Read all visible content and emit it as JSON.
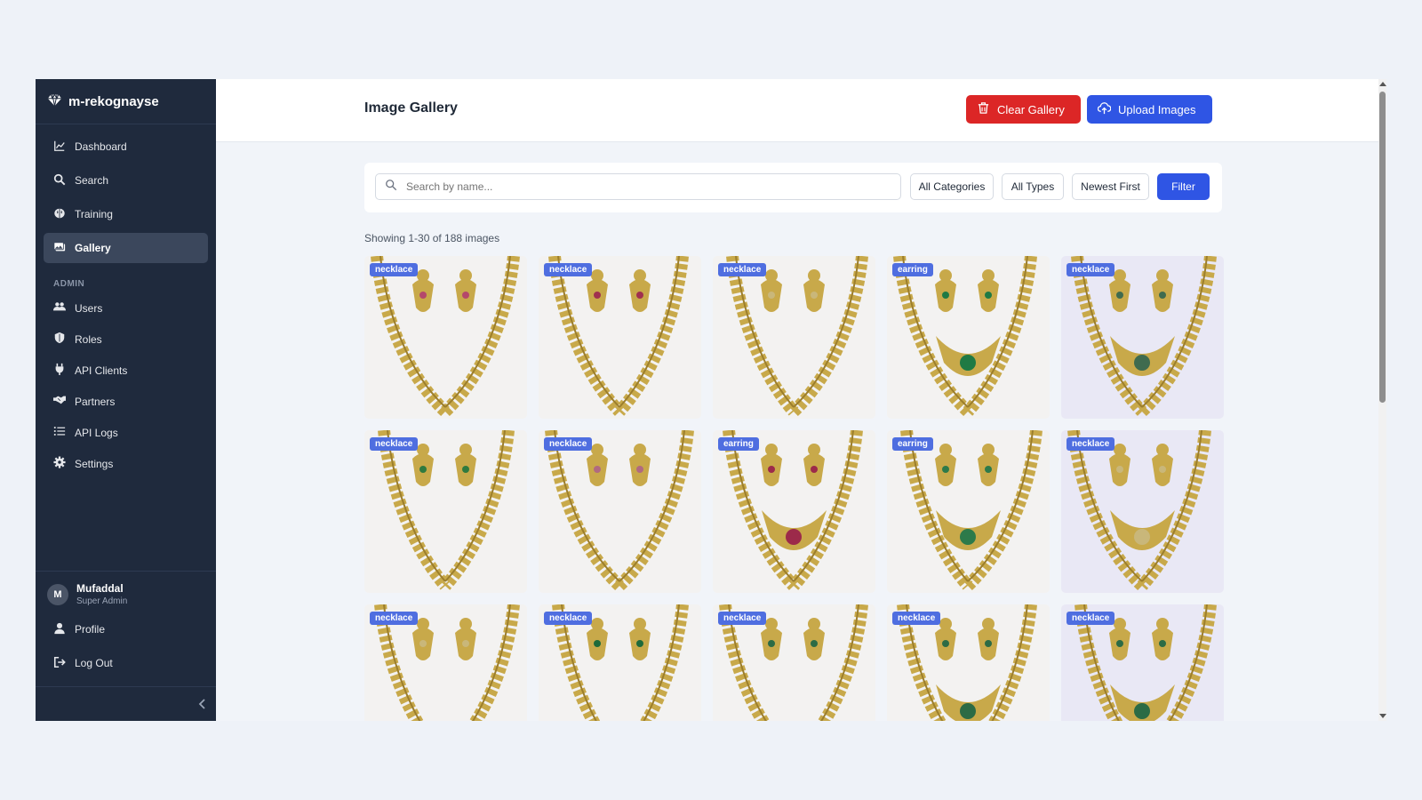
{
  "brand": {
    "name": "m-rekognayse"
  },
  "sidebar": {
    "items": [
      {
        "label": "Dashboard",
        "icon": "chart-line-icon"
      },
      {
        "label": "Search",
        "icon": "search-icon"
      },
      {
        "label": "Training",
        "icon": "brain-icon"
      },
      {
        "label": "Gallery",
        "icon": "images-icon",
        "active": true
      }
    ],
    "admin_label": "ADMIN",
    "admin_items": [
      {
        "label": "Users",
        "icon": "users-icon"
      },
      {
        "label": "Roles",
        "icon": "shield-icon"
      },
      {
        "label": "API Clients",
        "icon": "plug-icon"
      },
      {
        "label": "Partners",
        "icon": "handshake-icon"
      },
      {
        "label": "API Logs",
        "icon": "list-icon"
      },
      {
        "label": "Settings",
        "icon": "gear-icon"
      }
    ]
  },
  "user": {
    "initial": "M",
    "name": "Mufaddal",
    "role": "Super Admin",
    "profile_label": "Profile",
    "logout_label": "Log Out"
  },
  "header": {
    "title": "Image Gallery",
    "clear_label": "Clear Gallery",
    "upload_label": "Upload Images"
  },
  "filters": {
    "search_placeholder": "Search by name...",
    "category": "All Categories",
    "type": "All Types",
    "sort": "Newest First",
    "filter_label": "Filter"
  },
  "result_count": "Showing 1-30 of 188 images",
  "gallery": [
    {
      "tag": "necklace",
      "stones": "#b4486b"
    },
    {
      "tag": "necklace",
      "stones": "#a0304f"
    },
    {
      "tag": "necklace",
      "stones": "#c9b77a"
    },
    {
      "tag": "earring",
      "stones": "#1f7a44"
    },
    {
      "tag": "necklace",
      "stones": "#3f6b4f"
    },
    {
      "tag": "necklace",
      "stones": "#2f7a3f"
    },
    {
      "tag": "necklace",
      "stones": "#b06a80"
    },
    {
      "tag": "earring",
      "stones": "#9c2a4a"
    },
    {
      "tag": "earring",
      "stones": "#2d7a4a"
    },
    {
      "tag": "necklace",
      "stones": "#c9b77a"
    },
    {
      "tag": "necklace",
      "stones": "#c9b77a"
    },
    {
      "tag": "necklace",
      "stones": "#1e6a3a"
    },
    {
      "tag": "necklace",
      "stones": "#2c6b45"
    },
    {
      "tag": "necklace",
      "stones": "#2c6b45"
    },
    {
      "tag": "necklace",
      "stones": "#2c6b45"
    }
  ],
  "colors": {
    "sidebar_bg": "#1f2a3d",
    "danger": "#dc2626",
    "primary": "#2f55e4",
    "tag": "#4f6ee0",
    "gold": "#c8a94a"
  }
}
